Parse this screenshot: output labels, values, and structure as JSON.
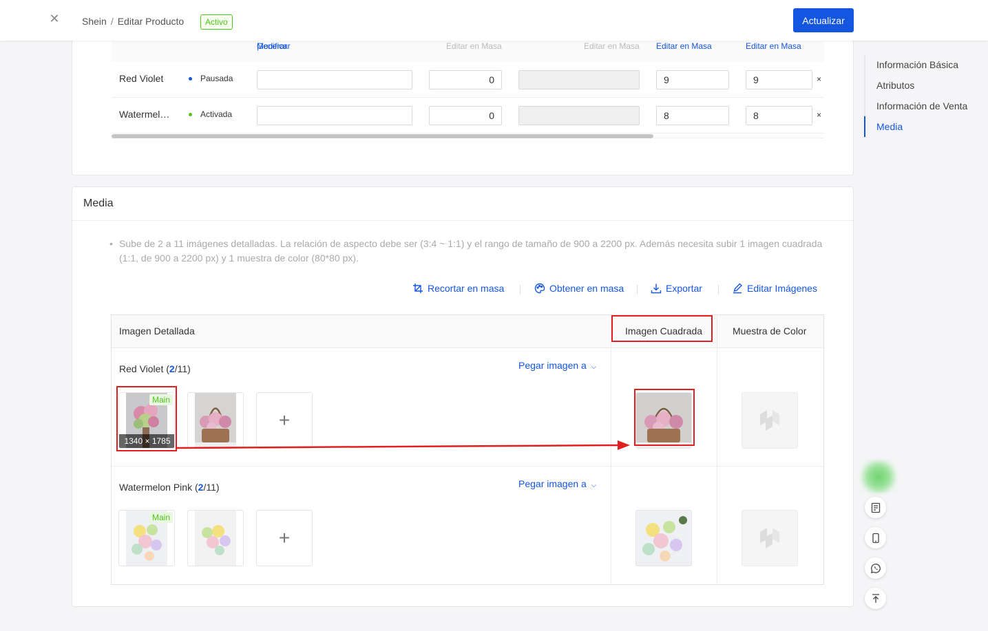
{
  "header": {
    "breadcrumb_root": "Shein",
    "breadcrumb_sep": "/",
    "breadcrumb_current": "Editar Producto",
    "status_badge": "Activo",
    "update_button": "Actualizar"
  },
  "side_nav": {
    "items": [
      {
        "label": "Información Básica"
      },
      {
        "label": "Atributos"
      },
      {
        "label": "Información de Venta"
      },
      {
        "label": "Media"
      }
    ],
    "active": "Media"
  },
  "variants_table": {
    "header": {
      "generate": "Generar",
      "divider": "|",
      "modify": "Modificar",
      "bulk_edit_1": "Editar en Masa",
      "bulk_edit_2": "Editar en Masa",
      "bulk_edit_3": "Editar en Masa",
      "bulk_edit_4": "Editar en Masa"
    },
    "rows": [
      {
        "name": "Red Violet",
        "status": "Pausada",
        "status_color": "#1456e0",
        "qty": "0",
        "val1": "9",
        "val2": "9",
        "remove": "×"
      },
      {
        "name": "Watermelon Pink",
        "status": "Activada",
        "status_color": "#52c41a",
        "qty": "0",
        "val1": "8",
        "val2": "8",
        "remove": "×"
      }
    ]
  },
  "media": {
    "title": "Media",
    "hint": "Sube de 2 a 11 imágenes detalladas. La relación de aspecto debe ser (3:4 ~ 1:1) y el rango de tamaño de 900 a 2200 px. Además necesita subir 1 imagen cuadrada (1:1, de 900 a 2200 px) y 1 muestra de color (80*80 px).",
    "hint_bullet": "•",
    "toolbar": {
      "crop": "Recortar en masa",
      "fetch": "Obtener en masa",
      "export": "Exportar",
      "edit": "Editar Imágenes"
    },
    "columns": {
      "detailed": "Imagen Detallada",
      "square": "Imagen Cuadrada",
      "swatch": "Muestra de Color"
    },
    "rows": [
      {
        "name": "Red Violet",
        "count": "2",
        "max": "11",
        "paste": "Pegar imagen a",
        "main_tag": "Main",
        "dimensions": "1340 × 1785"
      },
      {
        "name": "Watermelon Pink",
        "count": "2",
        "max": "11",
        "paste": "Pegar imagen a",
        "main_tag": "Main"
      }
    ],
    "add_symbol": "+"
  },
  "colors": {
    "primary": "#1456e0",
    "success": "#52c41a",
    "highlight": "#e02020"
  }
}
